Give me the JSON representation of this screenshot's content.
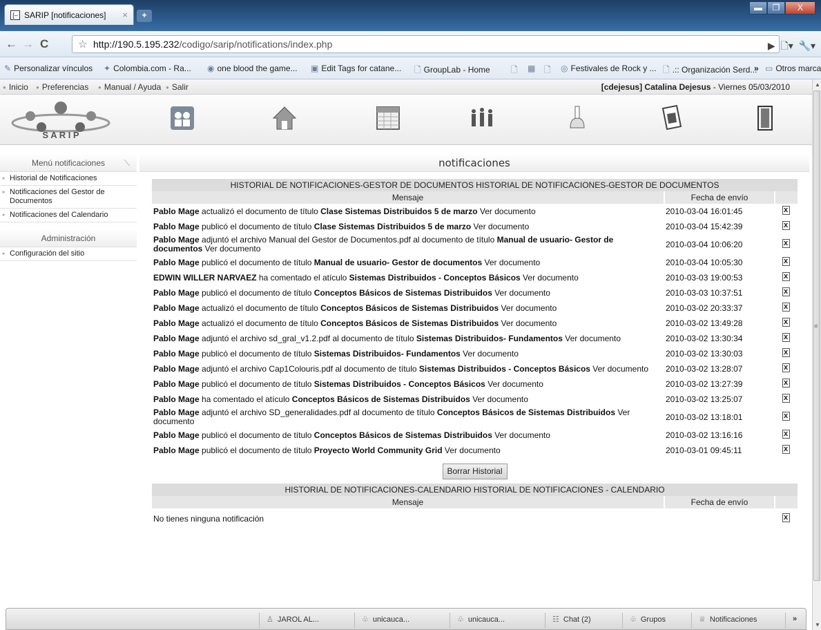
{
  "browser": {
    "tab_title": "SARIP [notificaciones]",
    "tab_close": "×",
    "new_tab": "+",
    "url_host": "http://190.5.195.232",
    "url_path": "/codigo/sarip/notifications/index.php",
    "window_buttons": {
      "min": "▬",
      "max": "❐",
      "close": "X"
    },
    "nav": {
      "back": "←",
      "forward": "→",
      "reload": "C"
    },
    "bookmarks": [
      "Personalizar vínculos",
      "Colombia.com - Ra...",
      "one blood the game...",
      "Edit Tags for catane...",
      "GroupLab - Home",
      "",
      "",
      "Festivales de Rock y ...",
      ".:: Organización Serd...",
      "»",
      "Otros marcadores"
    ]
  },
  "topmenu": {
    "items": [
      "Inicio",
      "Preferencias",
      "Manual / Ayuda",
      "Salir"
    ],
    "user_login": "[cdejesus] Catalina Dejesus",
    "date_text": " - Viernes 05/03/2010"
  },
  "logo_text": "S A R I P",
  "sidebar": {
    "menu_title": "Menú notificaciones",
    "items": [
      "Historial de Notificaciones",
      "Notificaciones del Gestor de Documentos",
      "Notificaciones del Calendario"
    ],
    "admin_title": "Administración",
    "admin_items": [
      "Configuración del sitio"
    ]
  },
  "main": {
    "title": "notificaciones",
    "docs_caption": "HISTORIAL DE NOTIFICACIONES-GESTOR DE DOCUMENTOS HISTORIAL DE NOTIFICACIONES-GESTOR DE DOCUMENTOS",
    "col_message": "Mensaje",
    "col_date": "Fecha de envío",
    "doc_rows": [
      {
        "actor": "Pablo Mage",
        "action": " actualizó el documento de título ",
        "subject": "Clase Sistemas Distribuidos 5 de marzo",
        "extra": "",
        "link": " Ver documento",
        "date": "2010-03-04 16:01:45"
      },
      {
        "actor": "Pablo Mage",
        "action": " publicó el documento de título ",
        "subject": "Clase Sistemas Distribuidos 5 de marzo",
        "extra": "",
        "link": " Ver documento",
        "date": "2010-03-04 15:42:39"
      },
      {
        "actor": "Pablo Mage",
        "action": " adjuntó el archivo Manual del Gestor de Documentos.pdf al documento de título ",
        "subject": "Manual de usuario- Gestor de documentos",
        "extra": "",
        "link": " Ver documento",
        "date": "2010-03-04 10:06:20"
      },
      {
        "actor": "Pablo Mage",
        "action": " publicó el documento de título ",
        "subject": "Manual de usuario- Gestor de documentos",
        "extra": "",
        "link": " Ver documento",
        "date": "2010-03-04 10:05:30"
      },
      {
        "actor": "EDWIN WILLER NARVAEZ",
        "action": " ha comentado el atículo ",
        "subject": "Sistemas Distribuidos - Conceptos Básicos",
        "extra": "",
        "link": " Ver documento",
        "date": "2010-03-03 19:00:53"
      },
      {
        "actor": "Pablo Mage",
        "action": " publicó el documento de título ",
        "subject": "Conceptos Básicos de Sistemas Distribuidos",
        "extra": "",
        "link": " Ver documento",
        "date": "2010-03-03 10:37:51"
      },
      {
        "actor": "Pablo Mage",
        "action": " actualizó el documento de título ",
        "subject": "Conceptos Básicos de Sistemas Distribuidos",
        "extra": "",
        "link": " Ver documento",
        "date": "2010-03-02 20:33:37"
      },
      {
        "actor": "Pablo Mage",
        "action": " actualizó el documento de título ",
        "subject": "Conceptos Básicos de Sistemas Distribuidos",
        "extra": "",
        "link": " Ver documento",
        "date": "2010-03-02 13:49:28"
      },
      {
        "actor": "Pablo Mage",
        "action": " adjuntó el archivo sd_gral_v1.2.pdf al documento de título ",
        "subject": "Sistemas Distribuidos- Fundamentos",
        "extra": "",
        "link": " Ver documento",
        "date": "2010-03-02 13:30:34"
      },
      {
        "actor": "Pablo Mage",
        "action": " publicó el documento de título ",
        "subject": "Sistemas Distribuidos- Fundamentos",
        "extra": "",
        "link": " Ver documento",
        "date": "2010-03-02 13:30:03"
      },
      {
        "actor": "Pablo Mage",
        "action": " adjuntó el archivo Cap1Colouris.pdf al documento de título ",
        "subject": "Sistemas Distribuidos - Conceptos Básicos",
        "extra": "",
        "link": " Ver documento",
        "date": "2010-03-02 13:28:07"
      },
      {
        "actor": "Pablo Mage",
        "action": " publicó el documento de título ",
        "subject": "Sistemas Distribuidos - Conceptos Básicos",
        "extra": "",
        "link": " Ver documento",
        "date": "2010-03-02 13:27:39"
      },
      {
        "actor": "Pablo Mage",
        "action": " ha comentado el atículo ",
        "subject": "Conceptos Básicos de Sistemas Distribuidos",
        "extra": "",
        "link": " Ver documento",
        "date": "2010-03-02 13:25:07"
      },
      {
        "actor": "Pablo Mage",
        "action": " adjuntó el archivo SD_generalidades.pdf al documento de título ",
        "subject": "Conceptos Básicos de Sistemas Distribuidos",
        "extra": "",
        "link": " Ver documento",
        "date": "2010-03-02 13:18:01"
      },
      {
        "actor": "Pablo Mage",
        "action": " publicó el documento de título ",
        "subject": "Conceptos Básicos de Sistemas Distribuidos",
        "extra": "",
        "link": " Ver documento",
        "date": "2010-03-02 13:16:16"
      },
      {
        "actor": "Pablo Mage",
        "action": " publicó el documento de título ",
        "subject": "Proyecto World Community Grid",
        "extra": "",
        "link": " Ver documento",
        "date": "2010-03-01 09:45:11"
      }
    ],
    "clear_button": "Borrar Historial",
    "cal_caption": "HISTORIAL DE NOTIFICACIONES-CALENDARIO HISTORIAL DE NOTIFICACIONES - CALENDARIO",
    "cal_empty": "No tienes ninguna notificación"
  },
  "chatbar": {
    "items": [
      "JAROL AL...",
      "unicauca...",
      "unicauca...",
      "Chat (2)",
      "Grupos",
      "Notificaciones"
    ],
    "expand": "»"
  }
}
